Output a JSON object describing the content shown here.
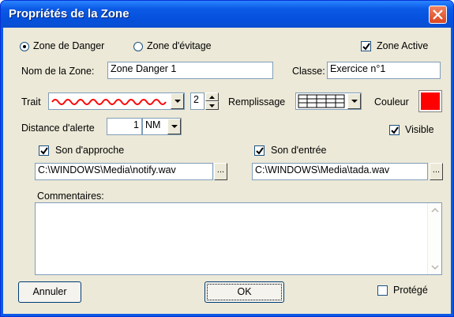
{
  "window": {
    "title": "Propriétés de la Zone"
  },
  "zone_type": {
    "option_danger": "Zone de Danger",
    "option_avoid": "Zone d'évitage",
    "selected": "Zone de Danger"
  },
  "zone_active": {
    "label": "Zone Active",
    "checked": true
  },
  "name": {
    "label": "Nom de la Zone:",
    "value": "Zone Danger 1"
  },
  "classe": {
    "label": "Classe:",
    "value": "Exercice n°1"
  },
  "trait": {
    "label": "Trait",
    "style": "wavy-line",
    "color": "#ff0000",
    "width": "2"
  },
  "remplissage": {
    "label": "Remplissage",
    "pattern": "grid"
  },
  "couleur": {
    "label": "Couleur",
    "color": "#ff0000"
  },
  "distance": {
    "label": "Distance d'alerte",
    "value": "1",
    "unit": "NM"
  },
  "visible": {
    "label": "Visible",
    "checked": true
  },
  "approach": {
    "label": "Son d'approche",
    "checked": true,
    "path": "C:\\WINDOWS\\Media\\notify.wav",
    "browse_label": "..."
  },
  "entry": {
    "label": "Son d'entrée",
    "checked": true,
    "path": "C:\\WINDOWS\\Media\\tada.wav",
    "browse_label": "..."
  },
  "comments": {
    "label": "Commentaires:",
    "value": ""
  },
  "buttons": {
    "cancel": "Annuler",
    "ok": "OK"
  },
  "protected": {
    "label": "Protégé",
    "checked": false
  }
}
